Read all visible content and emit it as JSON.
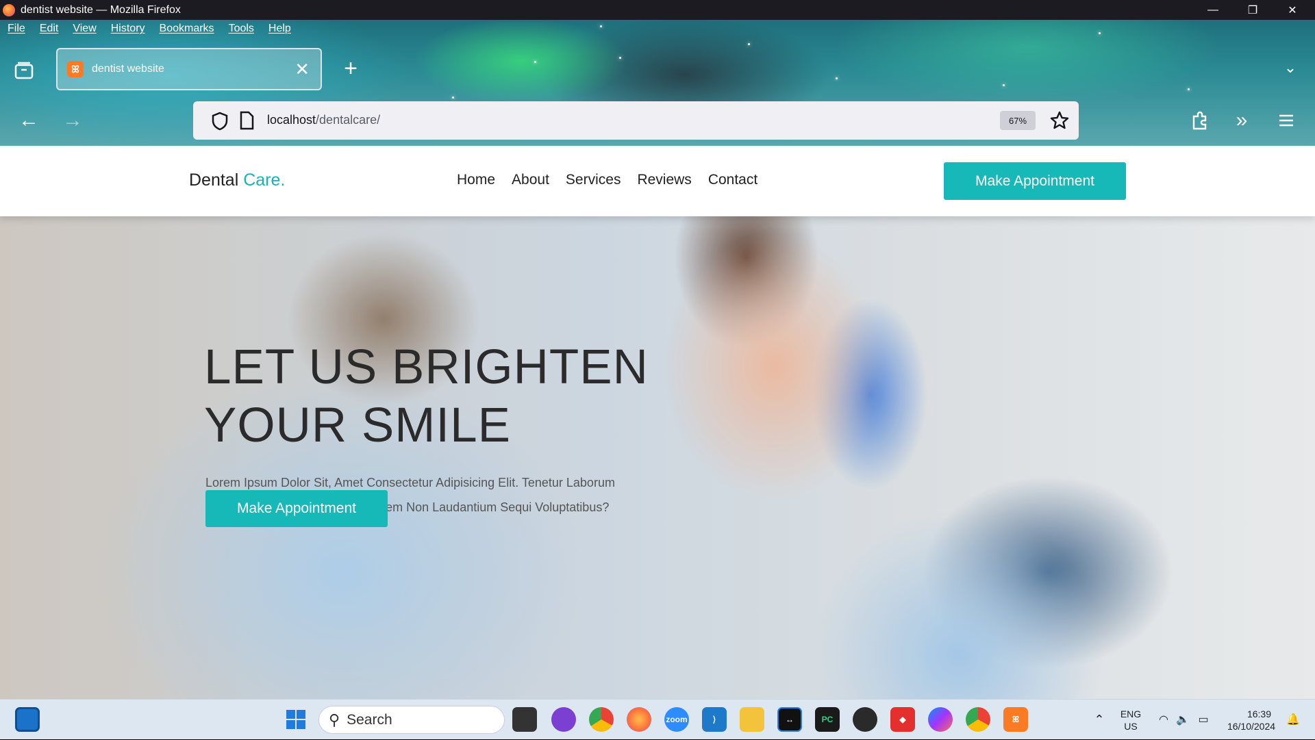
{
  "window": {
    "title": "dentist website — Mozilla Firefox",
    "controls": [
      "minimize",
      "restore",
      "close"
    ]
  },
  "menubar": {
    "items": [
      "File",
      "Edit",
      "View",
      "History",
      "Bookmarks",
      "Tools",
      "Help"
    ]
  },
  "tab": {
    "title": "dentist website"
  },
  "urlbar": {
    "host": "localhost",
    "path": "/dentalcare/",
    "zoom": "67%"
  },
  "site": {
    "logo_main": "Dental ",
    "logo_accent": "Care.",
    "nav": [
      "Home",
      "About",
      "Services",
      "Reviews",
      "Contact"
    ],
    "header_cta": "Make Appointment",
    "hero_title_line1": "LET US BRIGHTEN",
    "hero_title_line2": "YOUR SMILE",
    "hero_text": "Lorem Ipsum Dolor Sit, Amet Consectetur Adipisicing Elit. Tenetur Laborum Quod Minima Expedita Minus? Rem Non Laudantium Sequi Voluptatibus?",
    "hero_cta": "Make Appointment",
    "accent_color": "#17b8b8"
  },
  "taskbar": {
    "search_placeholder": "Search",
    "lang_line1": "ENG",
    "lang_line2": "US",
    "time": "16:39",
    "date": "16/10/2024",
    "apps": [
      "task-view",
      "copilot",
      "chrome",
      "firefox",
      "zoom",
      "vscode",
      "file-explorer",
      "teamviewer",
      "pycharm",
      "obs",
      "anydesk",
      "messenger",
      "chrome-profile",
      "xampp"
    ]
  }
}
